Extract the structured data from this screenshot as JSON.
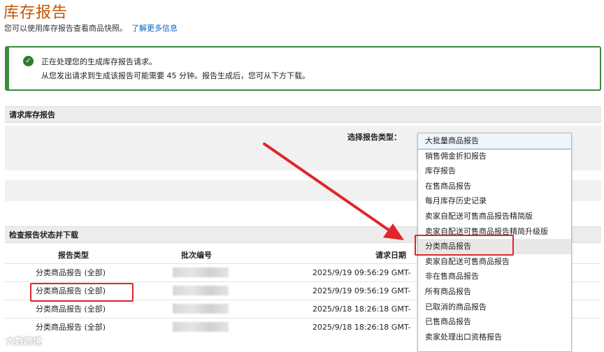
{
  "page": {
    "title": "库存报告",
    "subtitle": "您可以使用库存报告查看商品快照。",
    "learn_more": "了解更多信息"
  },
  "alert": {
    "line1": "正在处理您的生成库存报告请求。",
    "line2": "从您发出请求到生成该报告可能需要 45 分钟。报告生成后，您可从下方下载。"
  },
  "request": {
    "header": "请求库存报告",
    "select_label": "选择报告类型："
  },
  "dropdown": {
    "items": [
      "大批量商品报告",
      "销售佣金折扣报告",
      "库存报告",
      "在售商品报告",
      "每月库存历史记录",
      "卖家自配送可售商品报告精简版",
      "卖家自配送可售商品报告精简升级版",
      "分类商品报告",
      "卖家自配送可售商品报告",
      "非在售商品报告",
      "所有商品报告",
      "已取消的商品报告",
      "已售商品报告",
      "卖家处理出口资格报告"
    ]
  },
  "status": {
    "header": "检查报告状态并下载",
    "columns": [
      "报告类型",
      "批次编号",
      "请求日期"
    ],
    "rows": [
      {
        "type": "分类商品报告 (全部)",
        "date": "2025/9/19 09:56:29 GMT-"
      },
      {
        "type": "分类商品报告 (全部)",
        "date": "2025/9/19 09:56:19 GMT-"
      },
      {
        "type": "分类商品报告 (全部)",
        "date": "2025/9/18 18:26:18 GMT-"
      },
      {
        "type": "分类商品报告 (全部)",
        "date": "2025/9/18 18:26:18 GMT-"
      }
    ]
  },
  "watermark": "大数跨境",
  "colors": {
    "title": "#c45500",
    "alert": "#3b8a3e",
    "annotation": "#e0252b",
    "link": "#0066c0"
  }
}
